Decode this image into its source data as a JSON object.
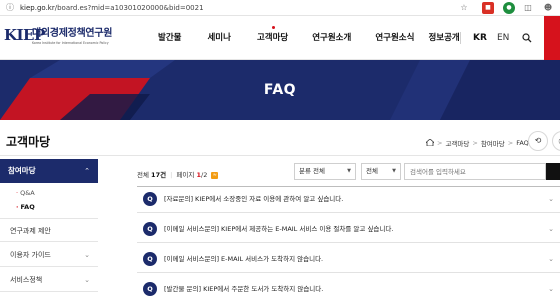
{
  "browser": {
    "url_host": "kiep.go.kr",
    "url_path": "/board.es?mid=a10301020000&bid=0021"
  },
  "header": {
    "logo_mark": "KIEP",
    "logo_name": "대외경제정책연구원",
    "logo_sub": "Korea Institute for International Economic Policy",
    "nav": [
      "발간물",
      "세미나",
      "고객마당",
      "연구원소개",
      "연구원소식",
      "정보공개"
    ],
    "lang_kr": "KR",
    "lang_en": "EN"
  },
  "hero": {
    "title": "FAQ"
  },
  "section": {
    "title": "고객마당",
    "breadcrumb": [
      "고객마당",
      "참여마당",
      "FAQ"
    ]
  },
  "sidebar": {
    "active": "참여마당",
    "sub_items": [
      "Q&A",
      "FAQ"
    ],
    "items": [
      "연구과제 제안",
      "이용자 가이드",
      "서비스정책"
    ]
  },
  "list": {
    "total_label": "전체",
    "total_count": "17건",
    "page_label": "페이지",
    "page_current": "1",
    "page_total": "/2",
    "category_select": "분류 전체",
    "field_select": "전체",
    "search_placeholder": "검색어를 입력하세요",
    "q_badge": "Q",
    "rows": [
      "[자료문의] KIEP에서 소장중인 자료 이용에 관하여 알고 싶습니다.",
      "[이메일 서비스문의] KIEP에서 제공하는 E-MAIL 서비스 이용 절차를 알고 싶습니다.",
      "[이메일 서비스문의] E-MAIL 서비스가 도착하지 않습니다.",
      "[발간물 문의] KIEP에서 주문한 도서가 도착하지 않습니다."
    ]
  },
  "colors": {
    "navy": "#1c2b6b",
    "red": "#d6121c"
  }
}
